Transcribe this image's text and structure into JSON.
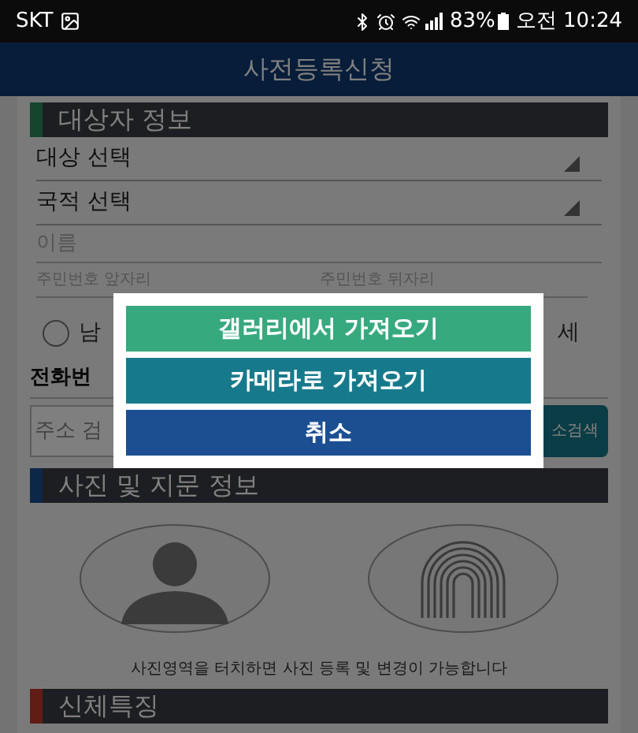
{
  "status_bar": {
    "carrier": "SKT",
    "battery": "83%",
    "time": "오전 10:24"
  },
  "app_bar": {
    "title": "사전등록신청"
  },
  "subject_info": {
    "header": "대상자 정보",
    "selects": [
      {
        "label": "대상 선택"
      },
      {
        "label": "국적 선택"
      }
    ],
    "name_field": {
      "placeholder": "이름"
    },
    "id_fields": [
      {
        "placeholder": "주민번호 앞자리"
      },
      {
        "placeholder": "주민번호 뒤자리"
      }
    ],
    "gender_radio": {
      "label": "남",
      "selected": false
    },
    "right_text": "세",
    "phone_label": "전화번",
    "address_field": {
      "placeholder": "주소 검"
    },
    "address_button": "소검색"
  },
  "photo_info": {
    "header": "사진 및 지문 정보",
    "caption": "사진영역을 터치하면 사진 등록 및 변경이 가능합니다"
  },
  "body_features": {
    "header": "신체특징"
  },
  "dialog": {
    "buttons": [
      {
        "label": "갤러리에서 가져오기",
        "kind": "gallery"
      },
      {
        "label": "카메라로 가져오기",
        "kind": "camera"
      },
      {
        "label": "취소",
        "kind": "cancel"
      }
    ]
  }
}
